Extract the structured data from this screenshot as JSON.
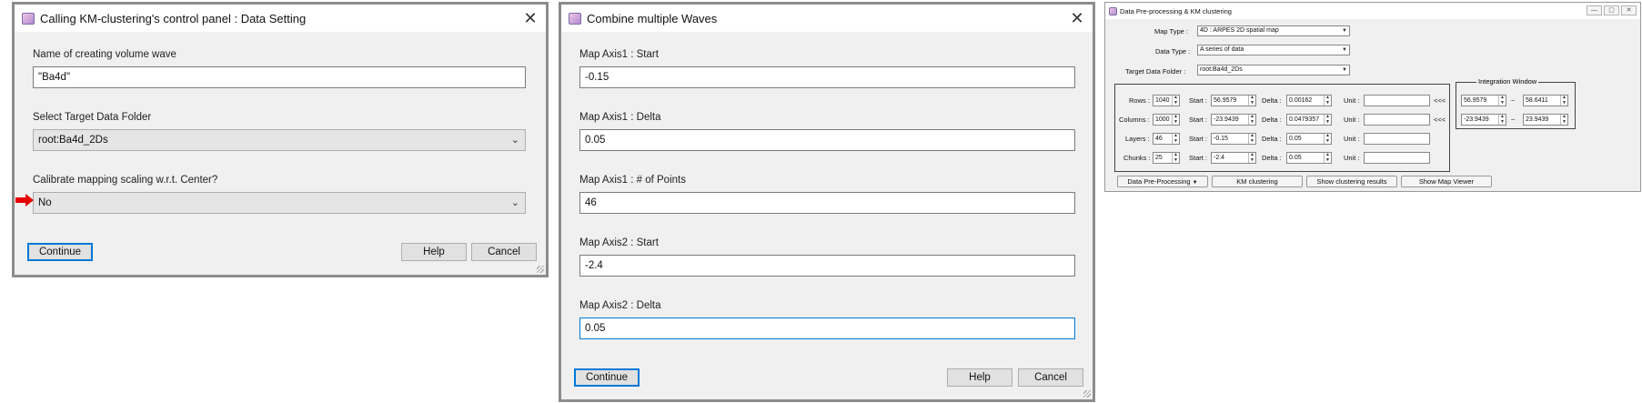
{
  "dialog1": {
    "title": "Calling KM-clustering's control panel : Data Setting",
    "name_label": "Name of creating volume wave",
    "name_value": "\"Ba4d\"",
    "folder_label": "Select Target Data Folder",
    "folder_value": "root:Ba4d_2Ds",
    "calibrate_label": "Calibrate mapping scaling w.r.t. Center?",
    "calibrate_value": "No",
    "continue": "Continue",
    "help": "Help",
    "cancel": "Cancel"
  },
  "dialog2": {
    "title": "Combine multiple Waves",
    "fields": [
      {
        "label": "Map Axis1 : Start",
        "value": "-0.15"
      },
      {
        "label": "Map Axis1 : Delta",
        "value": "0.05"
      },
      {
        "label": "Map Axis1 : # of Points",
        "value": "46"
      },
      {
        "label": "Map Axis2 : Start",
        "value": "-2.4"
      },
      {
        "label": "Map Axis2 : Delta",
        "value": "0.05"
      }
    ],
    "continue": "Continue",
    "help": "Help",
    "cancel": "Cancel"
  },
  "panel": {
    "title": "Data Pre-processing & KM clustering",
    "map_type_label": "Map Type :",
    "map_type_value": "4D : ARPES 2D spatial map",
    "data_type_label": "Data Type :",
    "data_type_value": "A series of data",
    "target_label": "Target Data Folder :",
    "target_value": "root:Ba4d_2Ds",
    "start_label": "Start :",
    "delta_label": "Delta :",
    "unit_label": "Unit :",
    "arrows": "<<<",
    "tilde": "~",
    "rows": [
      {
        "label": "Rows :",
        "count": "1040",
        "start": "56.9579",
        "delta": "0.00162",
        "unit": ""
      },
      {
        "label": "Columns :",
        "count": "1000",
        "start": "-23.9439",
        "delta": "0.0479357",
        "unit": ""
      },
      {
        "label": "Layers :",
        "count": "46",
        "start": "-0.15",
        "delta": "0.05",
        "unit": ""
      },
      {
        "label": "Chunks :",
        "count": "25",
        "start": "-2.4",
        "delta": "0.05",
        "unit": ""
      }
    ],
    "integration": {
      "title": "Integration Window",
      "r1_from": "56.9579",
      "r1_to": "58.6411",
      "r2_from": "-23.9439",
      "r2_to": "23.9439"
    },
    "buttons": {
      "preprocess": "Data Pre-Processing",
      "km": "KM clustering",
      "results": "Show clustering results",
      "viewer": "Show Map Viewer"
    }
  }
}
